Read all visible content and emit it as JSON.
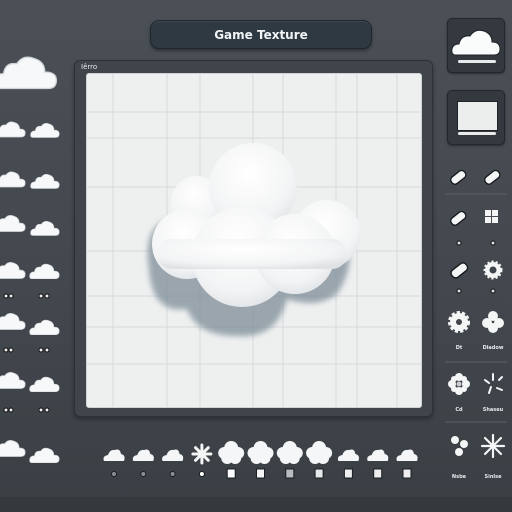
{
  "header": {
    "title": "Game Texture"
  },
  "canvas": {
    "label": "Iêrro",
    "subject": "cloud-sprite",
    "background": "#eef0f0",
    "grid_color": "#d7dbdd"
  },
  "left_strip": {
    "items": [
      {
        "icon": "cloud-icon",
        "size": "large"
      },
      {
        "icon": "cloud-icon"
      },
      {
        "icon": "cloud-icon"
      },
      {
        "icon": "cloud-icon"
      },
      {
        "icon": "cloud-icon"
      },
      {
        "icon": "cloud-icon"
      },
      {
        "icon": "cloud-icon"
      },
      {
        "icon": "cloud-icon"
      },
      {
        "icon": "cloud-icon"
      },
      {
        "icon": "cloud-icon"
      },
      {
        "icon": "cloud-icon"
      },
      {
        "icon": "cloud-icon"
      },
      {
        "icon": "cloud-icon"
      },
      {
        "icon": "cloud-icon"
      },
      {
        "icon": "cloud-icon"
      },
      {
        "icon": "cloud-icon"
      },
      {
        "icon": "cloud-icon"
      }
    ],
    "indicator_labels": [
      "oo",
      "oo"
    ]
  },
  "right_panel": {
    "thumbnails": [
      {
        "name": "cloud-preview",
        "icon": "cloud-icon"
      },
      {
        "name": "blank-preview",
        "icon": "square-icon"
      }
    ],
    "tools": [
      {
        "icon": "eraser-icon",
        "label": ""
      },
      {
        "icon": "eraser-soft-icon",
        "label": ""
      },
      {
        "icon": "eraser-icon",
        "label": ""
      },
      {
        "icon": "grid-icon",
        "label": ""
      },
      {
        "icon": "eraser-tip-icon",
        "label": ""
      },
      {
        "icon": "gear-icon",
        "label": ""
      },
      {
        "icon": "burst-icon",
        "label": "Dt"
      },
      {
        "icon": "blob-icon",
        "label": "Diadow"
      },
      {
        "icon": "flower-icon",
        "label": "Cd"
      },
      {
        "icon": "sparkle-icon",
        "label": "Shaseu"
      },
      {
        "icon": "particles-icon",
        "label": "Nsbe"
      },
      {
        "icon": "star-burst-icon",
        "label": "Sinlse"
      }
    ]
  },
  "bottom_strip": {
    "items": [
      {
        "icon": "cloud-icon",
        "marker": "dot",
        "color": "#8a9096"
      },
      {
        "icon": "cloud-icon",
        "marker": "dot",
        "color": "#8a9096"
      },
      {
        "icon": "cloud-icon",
        "marker": "dot",
        "color": "#8a9096"
      },
      {
        "icon": "asterisk-icon",
        "marker": "dot",
        "color": "#ffffff"
      },
      {
        "icon": "puffy-cloud-icon",
        "marker": "square",
        "color": "#ffffff"
      },
      {
        "icon": "puffy-cloud-icon",
        "marker": "square",
        "color": "#f4f5f6"
      },
      {
        "icon": "puffy-cloud-icon",
        "marker": "square",
        "color": "#b8bcbf"
      },
      {
        "icon": "puffy-cloud-icon",
        "marker": "square",
        "color": "#e6e8e9"
      },
      {
        "icon": "cloud-icon",
        "marker": "square",
        "color": "#eeeeee"
      },
      {
        "icon": "cloud-icon",
        "marker": "square",
        "color": "#eeeeee"
      },
      {
        "icon": "cloud-icon",
        "marker": "square",
        "color": "#eeeeee"
      }
    ]
  }
}
